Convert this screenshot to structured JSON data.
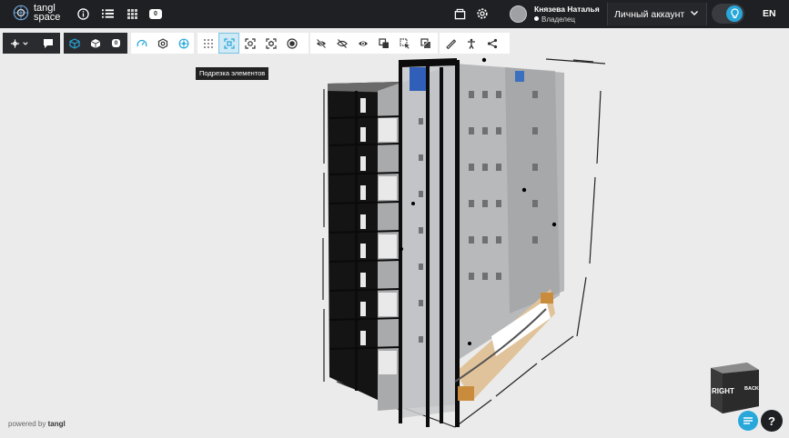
{
  "header": {
    "logo_text": "tangl\nspace",
    "user": {
      "name": "Князева Наталья",
      "role": "Владелец"
    },
    "account_label": "Личный аккаунт",
    "language": "EN",
    "badge_count": "0"
  },
  "toolbar": {
    "tooltip": "Подрезка элементов",
    "model_badge": "0"
  },
  "viewcube": {
    "right_label": "RIGHT",
    "back_label": "BACK"
  },
  "footer": {
    "powered_prefix": "powered by",
    "powered_brand": "tangl"
  },
  "help_label": "?",
  "colors": {
    "accent": "#27a7da",
    "topbar": "#1f2023",
    "toolbar_dark": "#2a2b2f",
    "active_bg": "#cfe9f5"
  }
}
